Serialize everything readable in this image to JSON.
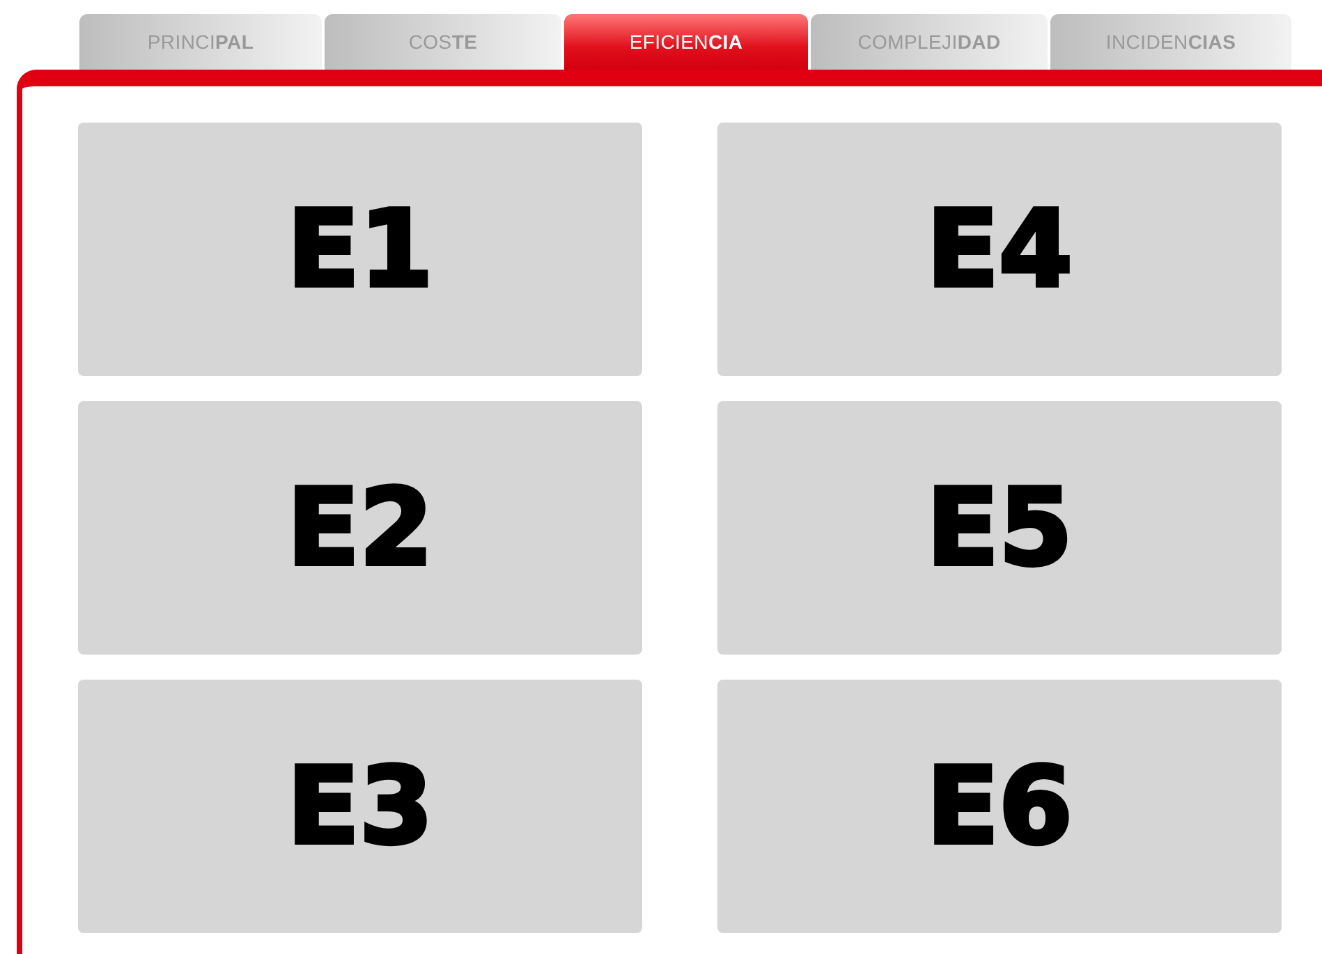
{
  "tabs": [
    {
      "label": "PRINCI**PAL**",
      "selected": false
    },
    {
      "label": "COS**TE**",
      "selected": false
    },
    {
      "label": "EFICIEN**CIA**",
      "selected": true
    },
    {
      "label": "COMPLEJI**DAD**",
      "selected": false
    },
    {
      "label": "INCIDEN**CIAS**",
      "selected": false
    }
  ],
  "tiles": [
    {
      "label": "E1"
    },
    {
      "label": "E4"
    },
    {
      "label": "E2"
    },
    {
      "label": "E5"
    },
    {
      "label": "E3"
    },
    {
      "label": "E6"
    }
  ]
}
